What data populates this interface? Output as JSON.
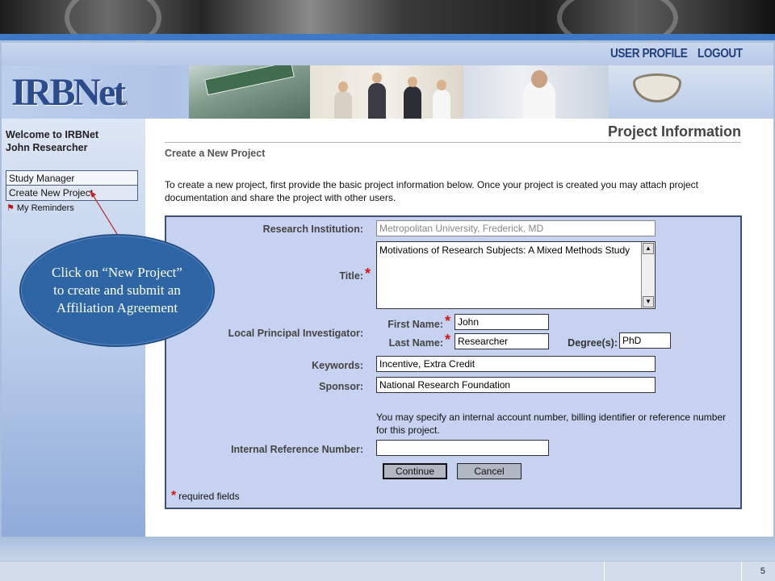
{
  "header": {
    "nav": {
      "user_profile": "USER PROFILE",
      "logout": "LOGOUT"
    },
    "logo": {
      "text": "IRBNet",
      "tm": "TM"
    }
  },
  "sidebar": {
    "welcome": "Welcome to IRBNet",
    "user_name": "John Researcher",
    "menu": [
      {
        "label": "Study Manager"
      },
      {
        "label": "Create New Project"
      }
    ],
    "reminders": "My Reminders"
  },
  "main": {
    "page_title": "Project Information",
    "subtitle": "Create a New Project",
    "intro": "To create a new project, first provide the basic project information below. Once your project is created you may attach project documentation and share the project with other users."
  },
  "form": {
    "institution": {
      "label": "Research Institution:",
      "value": "Metropolitan University, Frederick, MD"
    },
    "title": {
      "label": "Title:",
      "value": "Motivations of Research Subjects: A Mixed Methods Study"
    },
    "pi": {
      "label": "Local Principal Investigator:",
      "first_name_label": "First Name:",
      "first_name": "John",
      "last_name_label": "Last Name:",
      "last_name": "Researcher",
      "degree_label": "Degree(s):",
      "degree": "PhD"
    },
    "keywords": {
      "label": "Keywords:",
      "value": "Incentive, Extra Credit"
    },
    "sponsor": {
      "label": "Sponsor:",
      "value": "National Research Foundation"
    },
    "note": "You may specify an internal account number, billing identifier or reference number for this project.",
    "reference": {
      "label": "Internal Reference Number:",
      "value": ""
    },
    "continue_label": "Continue",
    "cancel_label": "Cancel",
    "required_note": "required fields",
    "required_mark": "*"
  },
  "callout": {
    "text": "Click on “New Project” to create and submit an Affiliation Agreement"
  },
  "footer": {
    "page_number": "5"
  },
  "colors": {
    "brand_blue": "#2c4b8c",
    "panel_bg": "#c6d2ef",
    "required_red": "#d21818",
    "callout_blue": "#2e65a4"
  }
}
